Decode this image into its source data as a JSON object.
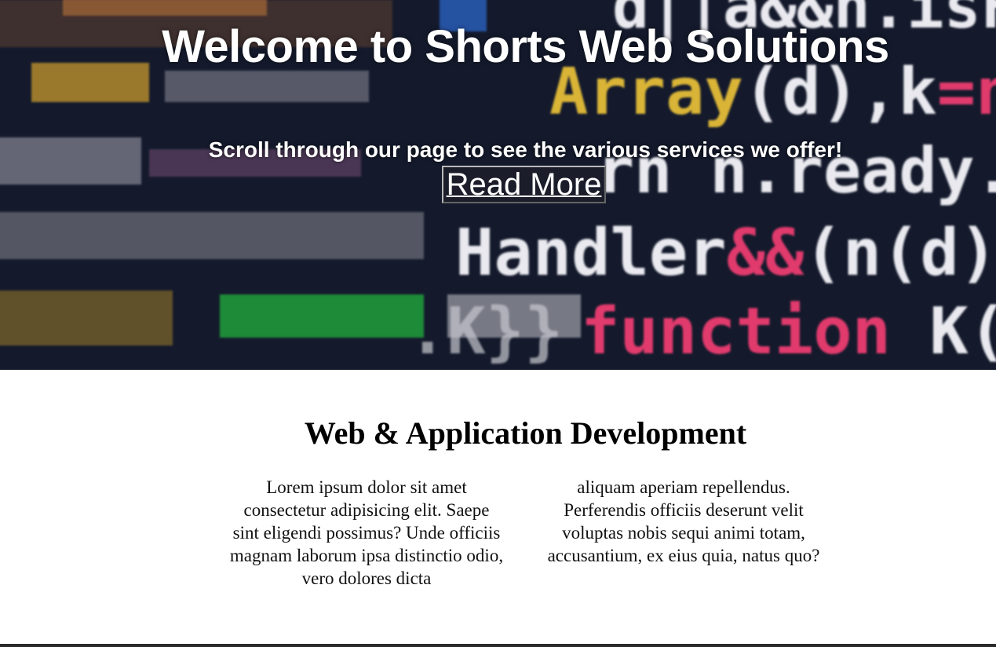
{
  "hero": {
    "title": "Welcome to Shorts Web Solutions",
    "subtitle": "Scroll through our page to see the various services we offer!",
    "button_label": "Read More",
    "background": "blurred-code-image"
  },
  "services": {
    "title": "Web & Application Development",
    "column_left": "Lorem ipsum dolor sit amet consectetur adipisicing elit. Saepe sint eligendi possimus? Unde officiis magnam laborum ipsa distinctio odio, vero dolores dicta",
    "column_right": "aliquam aperiam repellendus. Perferendis officiis deserunt velit voluptas nobis sequi animi totam, accusantium, ex eius quia, natus quo?"
  },
  "colors": {
    "hero_text": "#ffffff",
    "body_text": "#000000",
    "background": "#ffffff"
  }
}
